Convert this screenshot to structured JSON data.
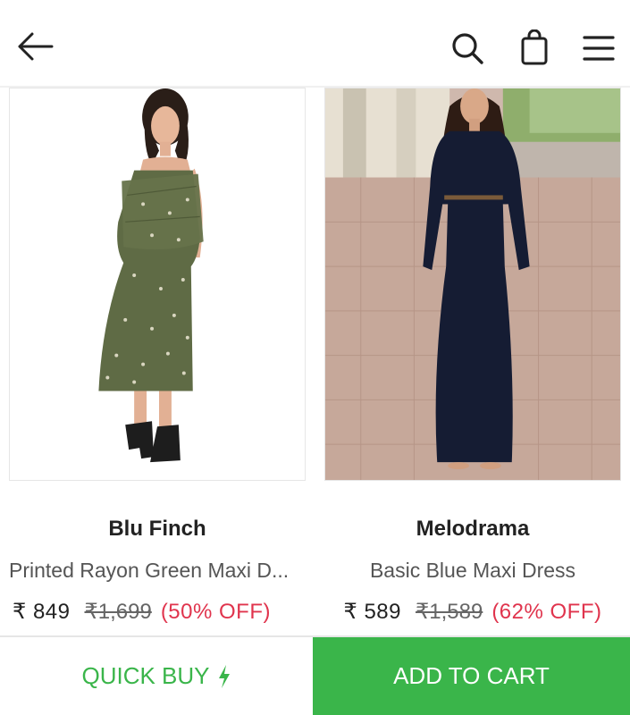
{
  "header": {
    "back_icon": "back-arrow-icon",
    "search_icon": "search-icon",
    "bag_icon": "shopping-bag-icon",
    "menu_icon": "hamburger-menu-icon"
  },
  "products": [
    {
      "brand": "Blu Finch",
      "title": "Printed Rayon Green Maxi D...",
      "price": "₹ 849",
      "mrp": "₹1,699",
      "discount": "(50% OFF)",
      "dress_color": "#5f6b45"
    },
    {
      "brand": "Melodrama",
      "title": "Basic Blue Maxi Dress",
      "price": "₹ 589",
      "mrp": "₹1,589",
      "discount": "(62% OFF)",
      "dress_color": "#151c33"
    }
  ],
  "actions": {
    "quick_buy_label": "QUICK BUY",
    "quick_buy_icon": "lightning-bolt-icon",
    "add_to_cart_label": "ADD TO CART"
  },
  "colors": {
    "accent_green": "#3ab54a",
    "discount_red": "#e0344d"
  }
}
